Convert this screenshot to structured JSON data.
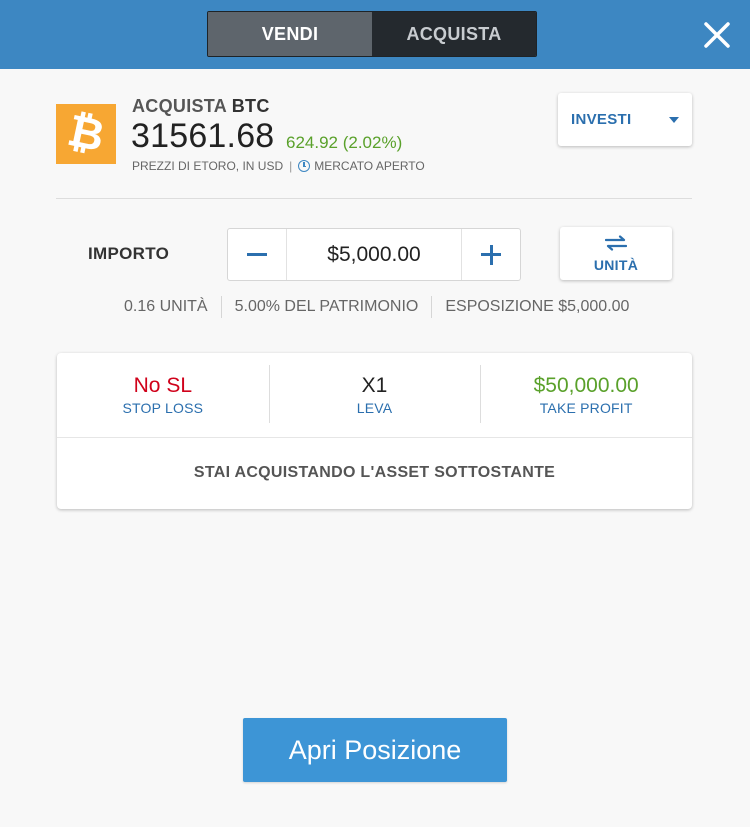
{
  "header": {
    "sell_label": "VENDI",
    "buy_label": "ACQUISTA",
    "active_tab": "sell",
    "close_icon": "close-icon"
  },
  "instrument": {
    "action": "ACQUISTA",
    "symbol": "BTC",
    "price": "31561.68",
    "change": "624.92 (2.02%)",
    "price_source": "PREZZI DI ETORO, IN USD",
    "separator": "|",
    "market_status": "MERCATO APERTO",
    "logo_glyph": "₿",
    "logo_color": "#f7a733",
    "change_color": "#5aa12b"
  },
  "invest_dropdown": {
    "label": "INVESTI"
  },
  "amount": {
    "label": "IMPORTO",
    "value": "$5,000.00",
    "minus_icon": "minus-icon",
    "plus_icon": "plus-icon",
    "units_button_label": "UNITÀ",
    "units": "0.16 UNITÀ",
    "equity_pct": "5.00% DEL PATRIMONIO",
    "exposure": "ESPOSIZIONE $5,000.00"
  },
  "trade_params": {
    "stop_loss": {
      "value": "No SL",
      "label": "STOP LOSS",
      "color": "#d0021b"
    },
    "leverage": {
      "value": "X1",
      "label": "LEVA"
    },
    "take_profit": {
      "value": "$50,000.00",
      "label": "TAKE PROFIT",
      "color": "#5aa12b"
    },
    "note": "STAI ACQUISTANDO L'ASSET SOTTOSTANTE"
  },
  "open_position_button": {
    "label": "Apri Posizione",
    "color": "#3d95d6"
  },
  "colors": {
    "header_bg": "#3d87c2",
    "accent": "#2b6fae"
  }
}
